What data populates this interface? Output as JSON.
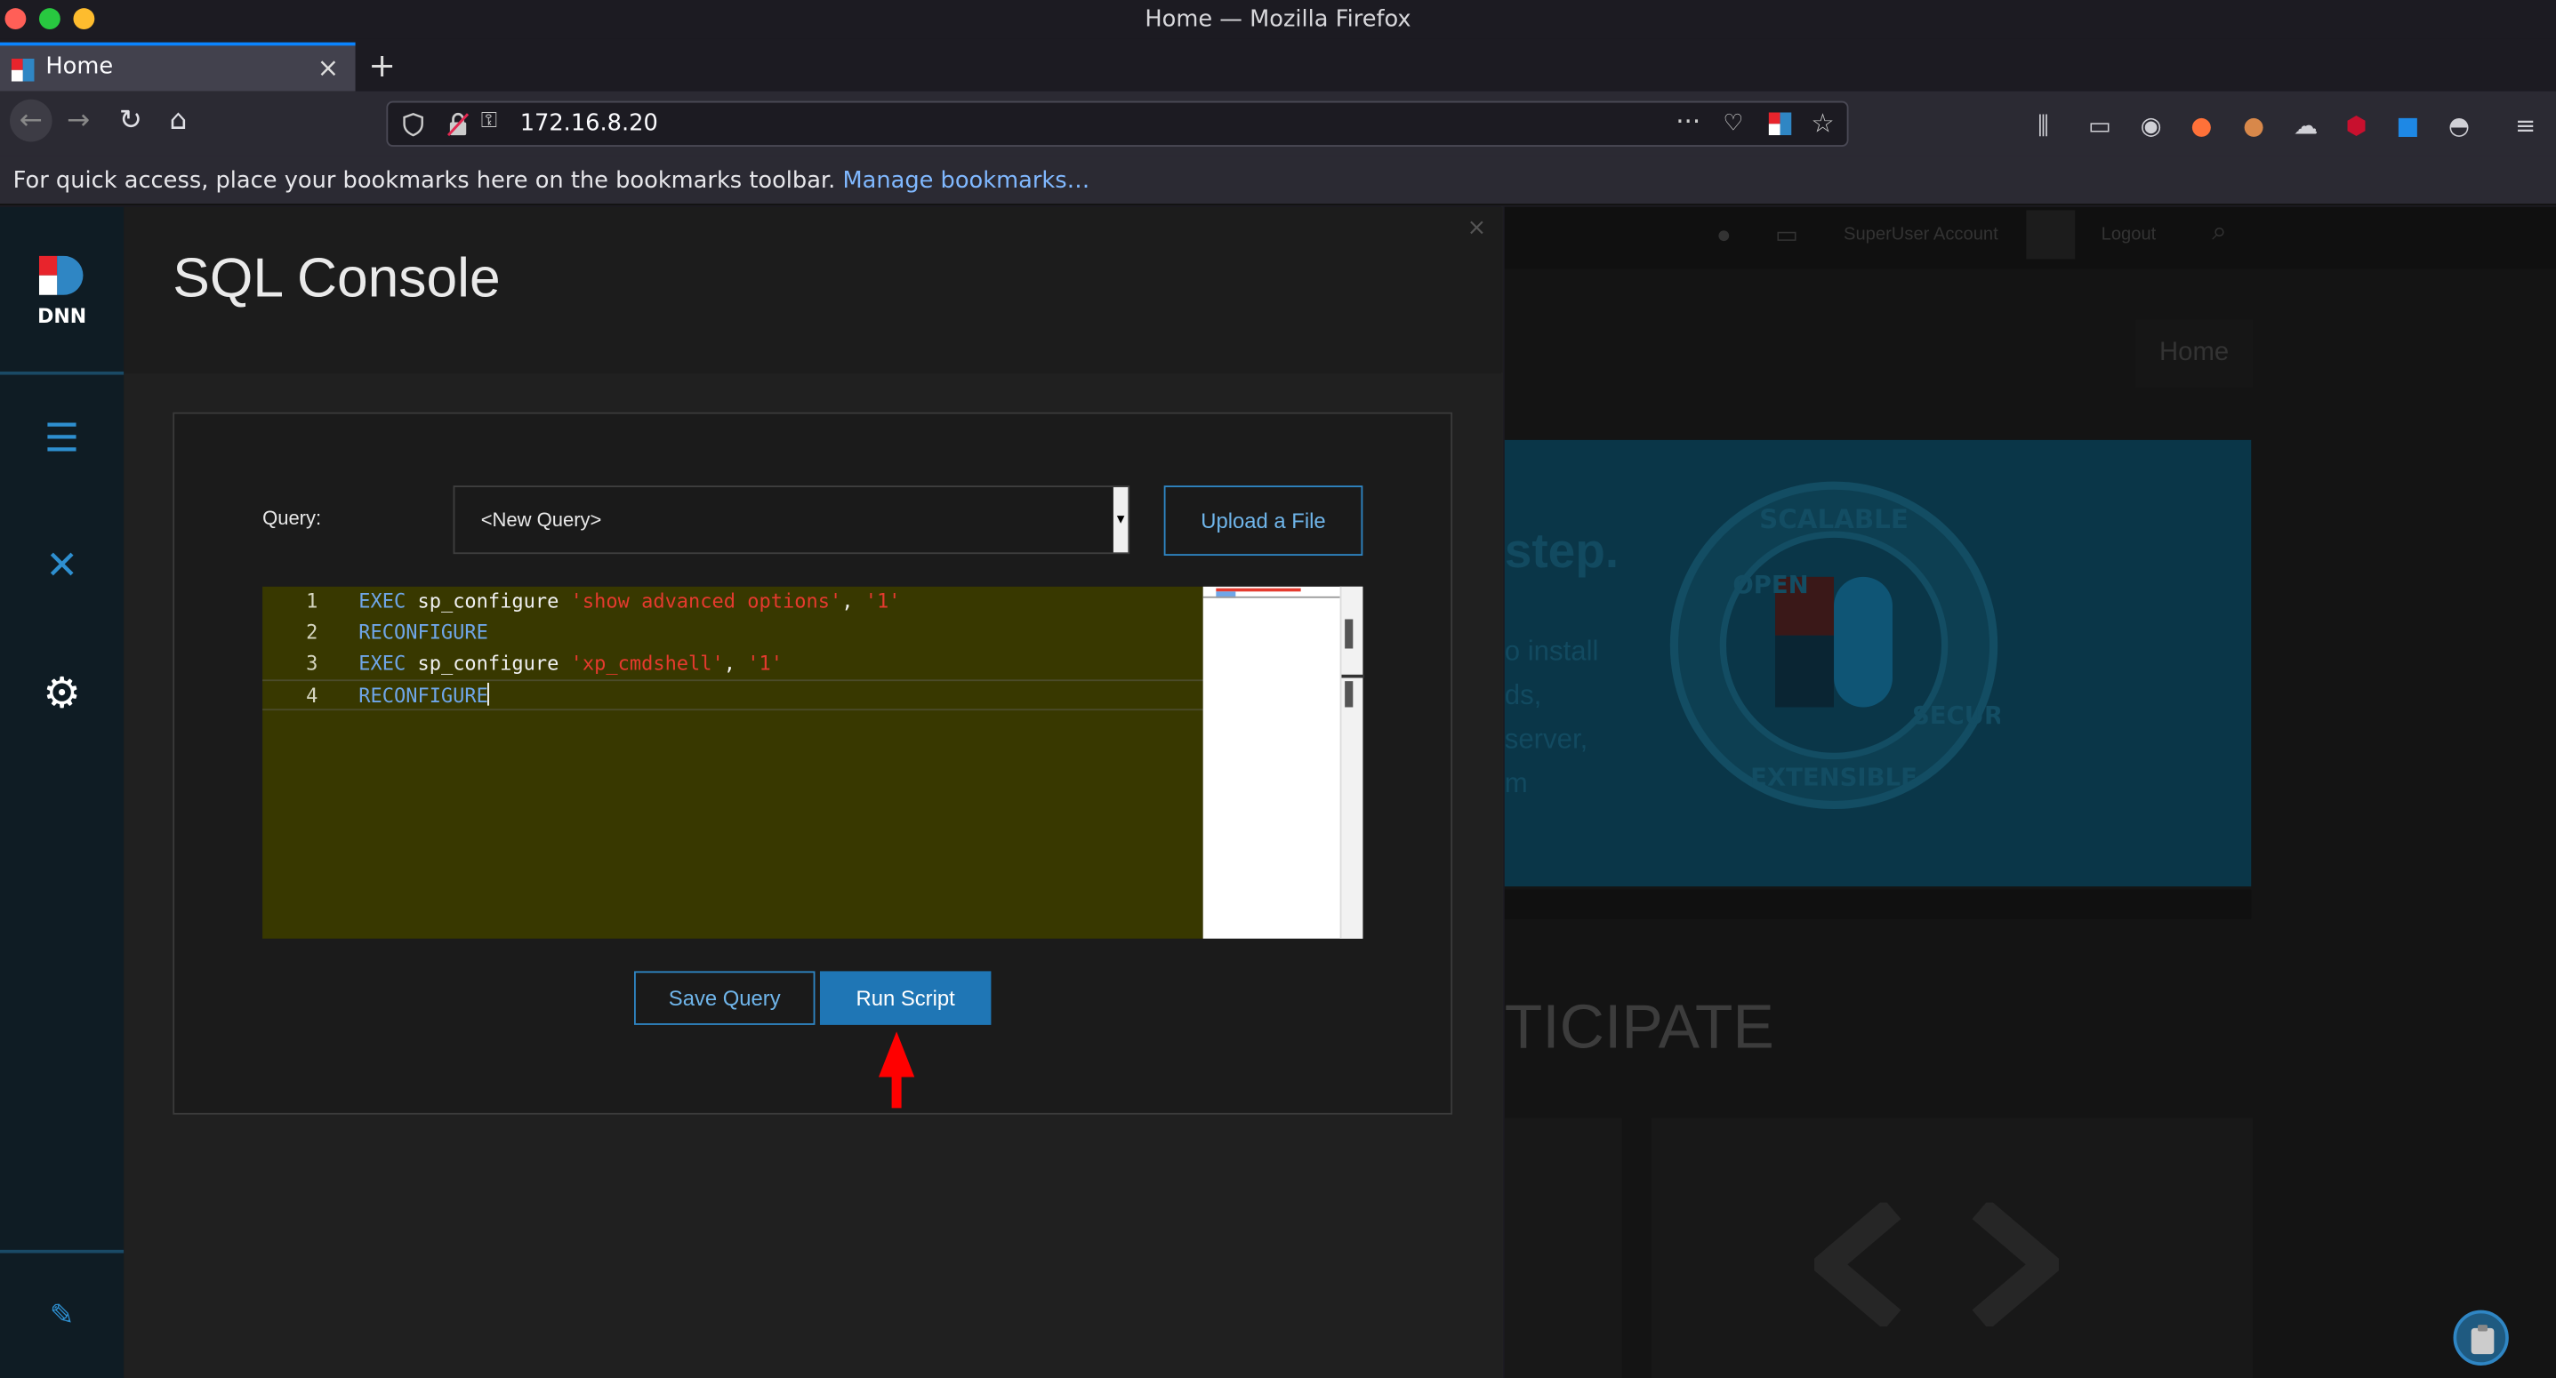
{
  "window": {
    "title": "Home — Mozilla Firefox"
  },
  "tab": {
    "label": "Home",
    "close": "×"
  },
  "browser": {
    "url": "172.16.8.20",
    "bookmarks_hint": "For quick access, place your bookmarks here on the bookmarks toolbar.",
    "bookmarks_link": "Manage bookmarks…",
    "new_tab": "+"
  },
  "dnn": {
    "logo_text": "DNN",
    "panel_title": "SQL Console",
    "panel_close": "×",
    "query_label": "Query:",
    "query_value": "<New Query>",
    "upload_label": "Upload a File",
    "save_label": "Save Query",
    "run_label": "Run Script",
    "code_lines": [
      {
        "num": "1",
        "kw": "EXEC",
        "text": " sp_configure ",
        "str1": "'show advanced options'",
        "sep": ", ",
        "str2": "'1'"
      },
      {
        "num": "2",
        "kw": "RECONFIGURE"
      },
      {
        "num": "3",
        "kw": "EXEC",
        "text": " sp_configure ",
        "str1": "'xp_cmdshell'",
        "sep": ", ",
        "str2": "'1'"
      },
      {
        "num": "4",
        "kw": "RECONFIGURE"
      }
    ]
  },
  "site": {
    "user": "SuperUser Account",
    "logout": "Logout",
    "nav_home": "Home",
    "hero_heading": "step.",
    "hero_lines": [
      "o install",
      "ds,",
      "server,",
      "m"
    ],
    "badge_words": [
      "OPEN",
      "SCALABLE",
      "EXTENSIBLE",
      "SECURE"
    ],
    "participate": "TICIPATE"
  },
  "colors": {
    "accent": "#1f76b5",
    "editor_bg": "#383800",
    "keyword": "#6fa6e8",
    "string": "#e53a2e",
    "arrow": "#ff0000"
  }
}
